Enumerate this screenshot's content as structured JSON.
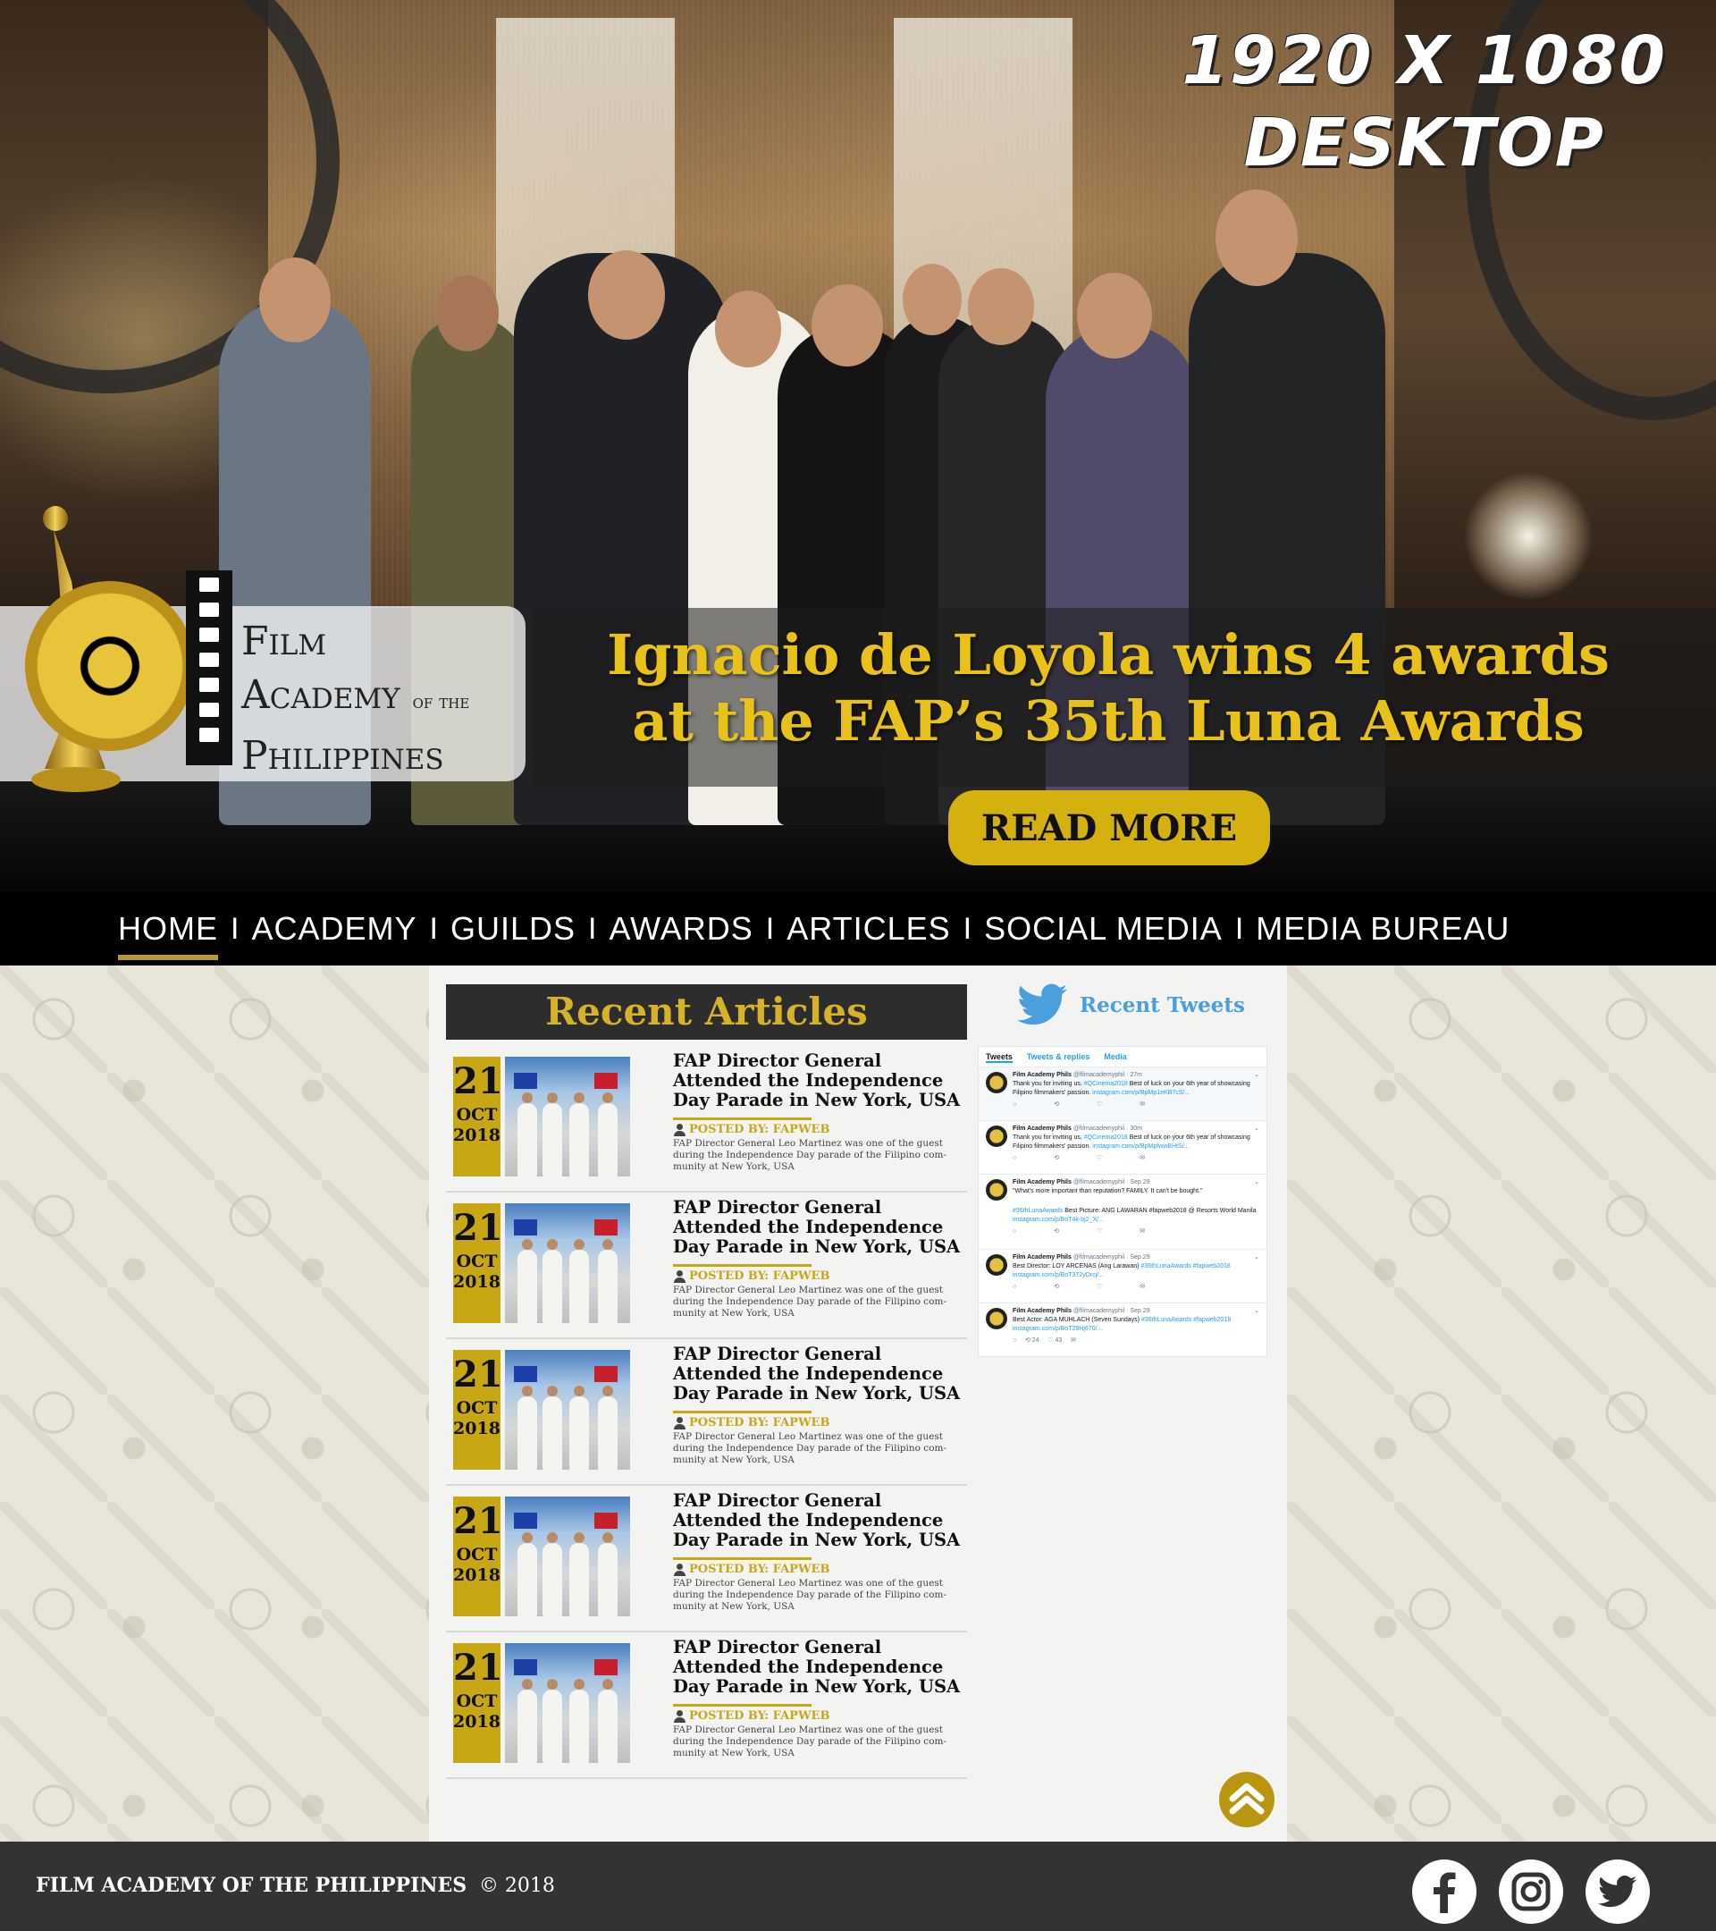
{
  "overlay": {
    "resolution_line1": "1920 X 1080",
    "resolution_line2": "DESKTOP"
  },
  "logo": {
    "line1": "Film",
    "line2": "Academy",
    "line2_small": "of the",
    "line3": "Philippines"
  },
  "hero": {
    "headline_line1": "Ignacio de Loyola wins 4 awards",
    "headline_line2": "at the FAP’s 35th Luna Awards",
    "cta_label": "READ MORE"
  },
  "nav": {
    "items": [
      {
        "label": "HOME",
        "active": true
      },
      {
        "label": "ACADEMY"
      },
      {
        "label": "GUILDS"
      },
      {
        "label": "AWARDS"
      },
      {
        "label": "ARTICLES"
      },
      {
        "label": "SOCIAL MEDIA"
      },
      {
        "label": "MEDIA BUREAU"
      }
    ],
    "separator": "I"
  },
  "recent_articles": {
    "heading": "Recent Articles",
    "items": [
      {
        "day": "21",
        "month": "OCT",
        "year": "2018",
        "title": "FAP Director General Attended the Independence Day Parade in New York, USA",
        "posted_by": "POSTED BY: FAPWEB",
        "excerpt": "FAP Director General Leo Martinez was one of the guest during the Independence Day parade of the Filipino com-munity at New York, USA"
      },
      {
        "day": "21",
        "month": "OCT",
        "year": "2018",
        "title": "FAP Director General Attended the Independence Day Parade in New York, USA",
        "posted_by": "POSTED BY: FAPWEB",
        "excerpt": "FAP Director General Leo Martinez was one of the guest during the Independence Day parade of the Filipino com-munity at New York, USA"
      },
      {
        "day": "21",
        "month": "OCT",
        "year": "2018",
        "title": "FAP Director General Attended the Independence Day Parade in New York, USA",
        "posted_by": "POSTED BY: FAPWEB",
        "excerpt": "FAP Director General Leo Martinez was one of the guest during the Independence Day parade of the Filipino com-munity at New York, USA"
      },
      {
        "day": "21",
        "month": "OCT",
        "year": "2018",
        "title": "FAP Director General Attended the Independence Day Parade in New York, USA",
        "posted_by": "POSTED BY: FAPWEB",
        "excerpt": "FAP Director General Leo Martinez was one of the guest during the Independence Day parade of the Filipino com-munity at New York, USA"
      },
      {
        "day": "21",
        "month": "OCT",
        "year": "2018",
        "title": "FAP Director General Attended the Independence Day Parade in New York, USA",
        "posted_by": "POSTED BY: FAPWEB",
        "excerpt": "FAP Director General Leo Martinez was one of the guest during the Independence Day parade of the Filipino com-munity at New York, USA"
      }
    ]
  },
  "recent_tweets": {
    "heading": "Recent Tweets",
    "tabs": [
      "Tweets",
      "Tweets & replies",
      "Media"
    ],
    "tweets": [
      {
        "name": "Film Academy Phils",
        "handle": "@filmacademyphil · 27m",
        "text": "Thank you for inviting  us, ",
        "tag": "#QCinema2018",
        "text2": " Best of luck on your 6th year of showcasing Filipino filmmakers' passion. ",
        "link": "instagram.com/p/BpMp1eKB7cS/...",
        "highlight": true
      },
      {
        "name": "Film Academy Phils",
        "handle": "@filmacademyphil · 30m",
        "text": "Thank you for inviting  us, ",
        "tag": "#QCinema2018",
        "text2": " Best of luck on your 6th year of showcasing Filipino filmmakers' passion. ",
        "link": "instagram.com/p/BpMpfwwBHtS/..."
      },
      {
        "name": "Film Academy Phils",
        "handle": "@filmacademyphil · Sep 29",
        "text": "\"What's more important than reputation? FAMILY. It can't be bought.\"",
        "tag": "#36thLunaAwards",
        "text2": " Best Picture: ANG LAWARAN #fapweb2018 @ Resorts World Manila ",
        "link": "instagram.com/p/BoT4k-bj2_X/..."
      },
      {
        "name": "Film Academy Phils",
        "handle": "@filmacademyphil · Sep 29",
        "text": "Best Director: LOY ARCENAS  (Ang Larawan) ",
        "tag": "#36thLunaAwards #fapweb2018",
        "text2": " ",
        "link": "instagram.com/p/BoT372yDrcj/..."
      },
      {
        "name": "Film Academy Phils",
        "handle": "@filmacademyphil · Sep 29",
        "text": "Best Actor: AGA MUHLACH (Seven Sundays) ",
        "tag": "#36thLunaAwards #fapweb2018",
        "text2": " ",
        "link": "instagram.com/p/BoT29Hj670/...",
        "retweets": "24",
        "likes": "43"
      }
    ]
  },
  "footer": {
    "org": "FILM ACADEMY OF THE PHILIPPINES",
    "copyright": "©  2018"
  },
  "social": [
    "facebook-icon",
    "instagram-icon",
    "twitter-icon"
  ],
  "colors": {
    "gold": "#c7a714",
    "nav_bg": "#000000",
    "footer_bg": "#333333",
    "twitter_blue": "#4a9fdc"
  }
}
